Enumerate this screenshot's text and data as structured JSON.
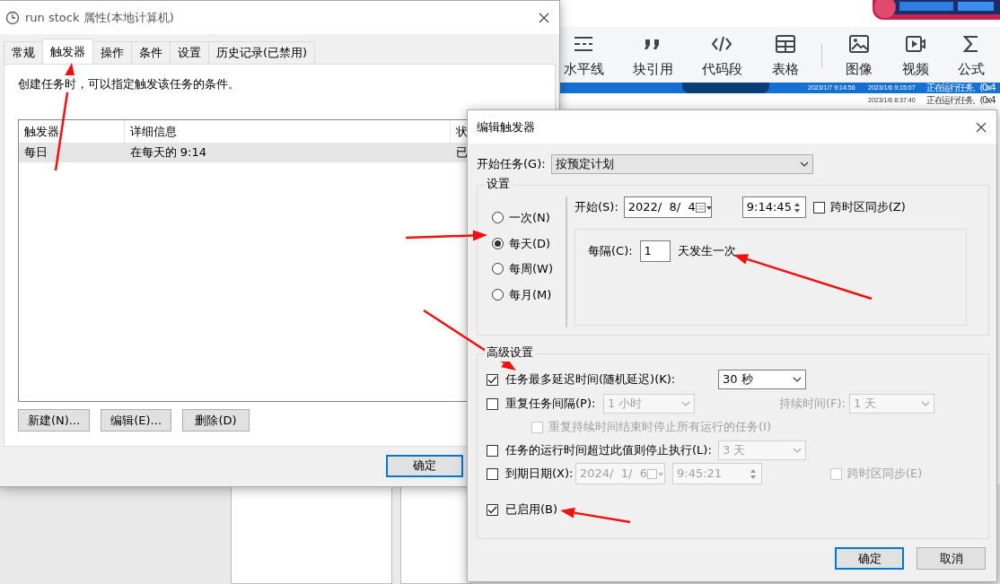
{
  "editor_toolbar": {
    "items": [
      {
        "label": "水平线"
      },
      {
        "label": "块引用"
      },
      {
        "label": "代码段"
      },
      {
        "label": "表格"
      },
      {
        "label": "图像"
      },
      {
        "label": "视频"
      },
      {
        "label": "公式"
      }
    ]
  },
  "task_history": {
    "rows": [
      {
        "cells": [
          "2023/1/7 9:14:56",
          "2023/1/6 9:15:07",
          "正在运行任务。(0x4"
        ],
        "selected": true
      },
      {
        "cells": [
          "",
          "2023/1/6 8:37:40",
          "正在运行任务。(0x4"
        ],
        "selected": false
      }
    ]
  },
  "properties_window": {
    "title": "run stock 属性(本地计算机)",
    "tabs": [
      {
        "label": "常规",
        "selected": false
      },
      {
        "label": "触发器",
        "selected": true
      },
      {
        "label": "操作",
        "selected": false
      },
      {
        "label": "条件",
        "selected": false
      },
      {
        "label": "设置",
        "selected": false
      },
      {
        "label": "历史记录(已禁用)",
        "selected": false
      }
    ],
    "description": "创建任务时，可以指定触发该任务的条件。",
    "table": {
      "columns": [
        "触发器",
        "详细信息",
        "状"
      ],
      "rows": [
        {
          "cells": [
            "每日",
            "在每天的 9:14",
            "已"
          ],
          "selected": true
        }
      ]
    },
    "buttons": [
      "新建(N)...",
      "编辑(E)...",
      "删除(D)"
    ],
    "ok_button": "确定"
  },
  "trigger_dialog": {
    "title": "编辑触发器",
    "start_task": {
      "label": "开始任务(G):",
      "value": "按预定计划"
    },
    "settings": {
      "legend": "设置",
      "schedules": [
        {
          "label": "一次(N)",
          "selected": false
        },
        {
          "label": "每天(D)",
          "selected": true
        },
        {
          "label": "每周(W)",
          "selected": false
        },
        {
          "label": "每月(M)",
          "selected": false
        }
      ],
      "start_label": "开始(S):",
      "start_date": "2022/  8/  4",
      "start_time": "9:14:45",
      "sync": {
        "label": "跨时区同步(Z)",
        "checked": false,
        "disabled": false
      },
      "recur_label": "每隔(C):",
      "recur_value": "1",
      "recur_unit": "天发生一次"
    },
    "advanced": {
      "legend": "高级设置",
      "delay": {
        "label": "任务最多延迟时间(随机延迟)(K):",
        "checked": true,
        "disabled": false,
        "value": "30 秒"
      },
      "repeat": {
        "label": "重复任务间隔(P):",
        "checked": false,
        "disabled": false,
        "value": "1 小时",
        "value_disabled": true,
        "duration_label": "持续时间(F):",
        "duration": "1 天"
      },
      "stop_all": {
        "label": "重复持续时间结束时停止所有运行的任务(I)",
        "checked": false,
        "disabled": true
      },
      "stop_after": {
        "label": "任务的运行时间超过此值则停止执行(L):",
        "checked": false,
        "disabled": false,
        "value": "3 天",
        "value_disabled": true
      },
      "expire": {
        "label": "到期日期(X):",
        "checked": false,
        "disabled": false,
        "date": "2024/  1/  6",
        "time": "9:45:21",
        "fields_disabled": true
      },
      "expire_sync": {
        "label": "跨时区同步(E)",
        "checked": false,
        "disabled": true
      },
      "enabled": {
        "label": "已启用(B)",
        "checked": true,
        "disabled": false
      }
    },
    "buttons": [
      {
        "label": "确定",
        "kind": "default"
      },
      {
        "label": "取消",
        "kind": "normal"
      }
    ]
  }
}
